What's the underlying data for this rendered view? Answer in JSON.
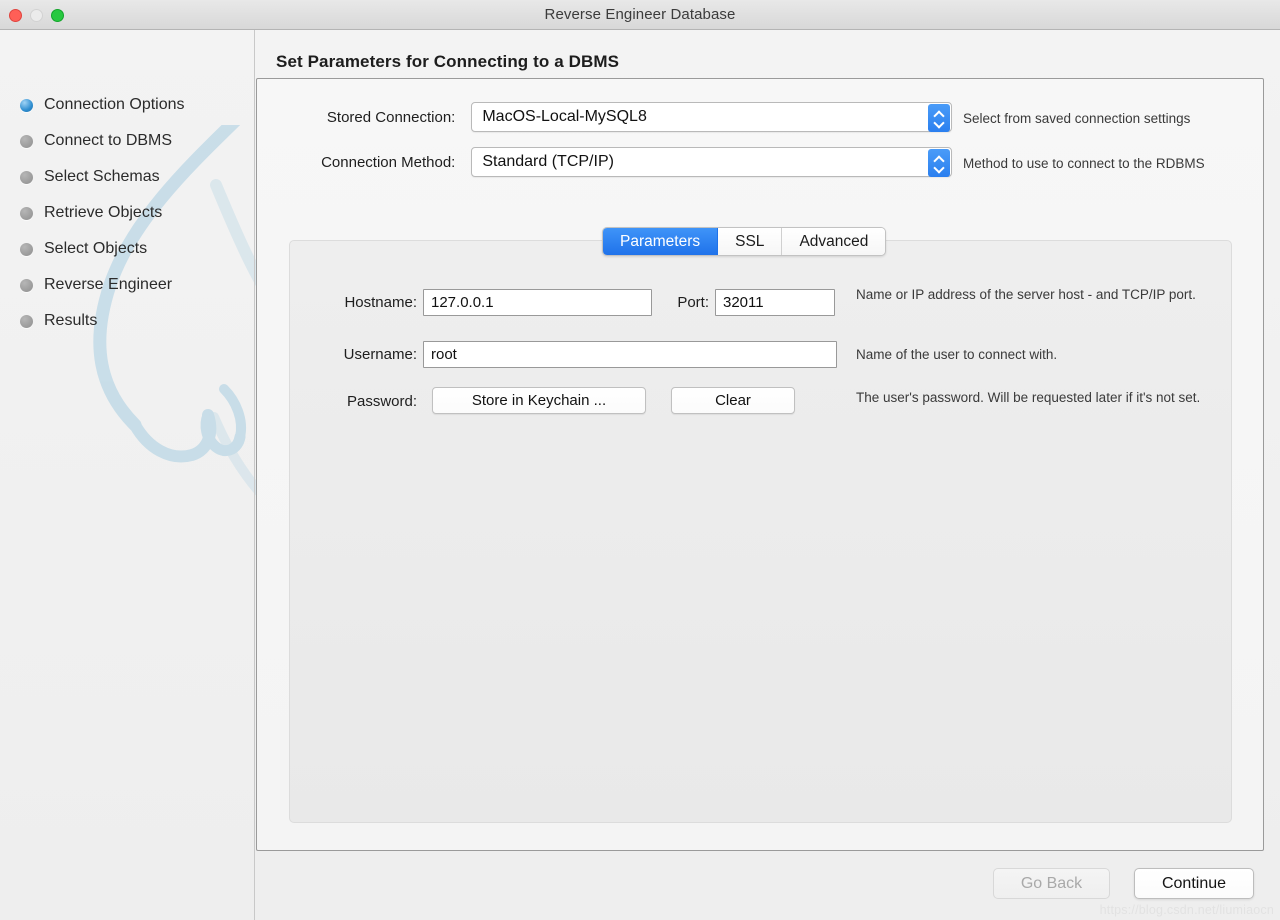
{
  "window": {
    "title": "Reverse Engineer Database",
    "controls": [
      "close-button",
      "minimize-button",
      "maximize-button"
    ]
  },
  "sidebar": {
    "items": [
      {
        "label": "Connection Options",
        "state": "active"
      },
      {
        "label": "Connect to DBMS",
        "state": "inactive"
      },
      {
        "label": "Select Schemas",
        "state": "inactive"
      },
      {
        "label": "Retrieve Objects",
        "state": "inactive"
      },
      {
        "label": "Select Objects",
        "state": "inactive"
      },
      {
        "label": "Reverse Engineer",
        "state": "inactive"
      },
      {
        "label": "Results",
        "state": "inactive"
      }
    ]
  },
  "main": {
    "page_title": "Set Parameters for Connecting to a DBMS",
    "stored_connection": {
      "label": "Stored Connection:",
      "value": "MacOS-Local-MySQL8",
      "hint": "Select from saved connection settings"
    },
    "connection_method": {
      "label": "Connection Method:",
      "value": "Standard (TCP/IP)",
      "hint": "Method to use to connect to the RDBMS"
    },
    "tabs": [
      {
        "label": "Parameters",
        "selected": true
      },
      {
        "label": "SSL",
        "selected": false
      },
      {
        "label": "Advanced",
        "selected": false
      }
    ],
    "parameters": {
      "hostname": {
        "label": "Hostname:",
        "value": "127.0.0.1",
        "hint": "Name or IP address of the server host - and TCP/IP port."
      },
      "port": {
        "label": "Port:",
        "value": "32011"
      },
      "username": {
        "label": "Username:",
        "value": "root",
        "hint": "Name of the user to connect with."
      },
      "password": {
        "label": "Password:",
        "store_button": "Store in Keychain ...",
        "clear_button": "Clear",
        "hint": "The user's password. Will be requested later if it's not set."
      }
    }
  },
  "footer": {
    "go_back": "Go Back",
    "continue": "Continue"
  },
  "watermark": "https://blog.csdn.net/liumiaocn",
  "colors": {
    "accent_blue": "#2a7fef",
    "tab_selected": "#1f72ea",
    "close": "#ff5f57",
    "minimize": "#ebebeb",
    "maximize": "#28c840",
    "dolphin": "#bcd7e4"
  }
}
